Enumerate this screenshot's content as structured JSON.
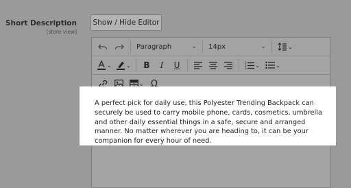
{
  "field": {
    "label": "Short Description",
    "scope": "[store view]"
  },
  "toggle_button": "Show / Hide Editor",
  "toolbar": {
    "undo_icon": "undo-icon",
    "redo_icon": "redo-icon",
    "block_format": "Paragraph",
    "font_size": "14px",
    "line_height_icon": "line-height-icon",
    "text_color_icon": "text-color-icon",
    "highlight_icon": "highlight-icon",
    "bold": "B",
    "italic": "I",
    "underline": "U",
    "align_left_icon": "align-left-icon",
    "align_center_icon": "align-center-icon",
    "align_right_icon": "align-right-icon",
    "numbered_list_icon": "numbered-list-icon",
    "bullet_list_icon": "bullet-list-icon",
    "link_icon": "link-icon",
    "image_icon": "image-icon",
    "table_icon": "table-icon",
    "special_char": "Ω"
  },
  "content": {
    "text": "A perfect pick for daily use, this Polyester Trending Backpack can securely be used to carry mobile phone, cards, cosmetics, umbrella and other daily essential things in a safe, secure and arranged manner. No matter wherever you are heading to, it can be your companion for every hour of need."
  },
  "colors": {
    "overlay": "#9a9a9a",
    "highlight_box": "#ffffff"
  }
}
